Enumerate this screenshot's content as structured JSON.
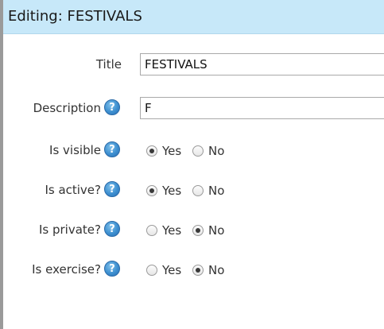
{
  "header": {
    "title": "Editing: FESTIVALS"
  },
  "form": {
    "title": {
      "label": "Title",
      "value": "FESTIVALS"
    },
    "description": {
      "label": "Description",
      "value": "F",
      "help": "?"
    },
    "is_visible": {
      "label": "Is visible",
      "help": "?",
      "yes": "Yes",
      "no": "No",
      "selected": "Yes"
    },
    "is_active": {
      "label": "Is active?",
      "help": "?",
      "yes": "Yes",
      "no": "No",
      "selected": "Yes"
    },
    "is_private": {
      "label": "Is private?",
      "help": "?",
      "yes": "Yes",
      "no": "No",
      "selected": "No"
    },
    "is_exercise": {
      "label": "Is exercise?",
      "help": "?",
      "yes": "Yes",
      "no": "No",
      "selected": "No"
    }
  },
  "colors": {
    "header_bg": "#c7e8f9",
    "help_icon": "#3d8fd0"
  }
}
